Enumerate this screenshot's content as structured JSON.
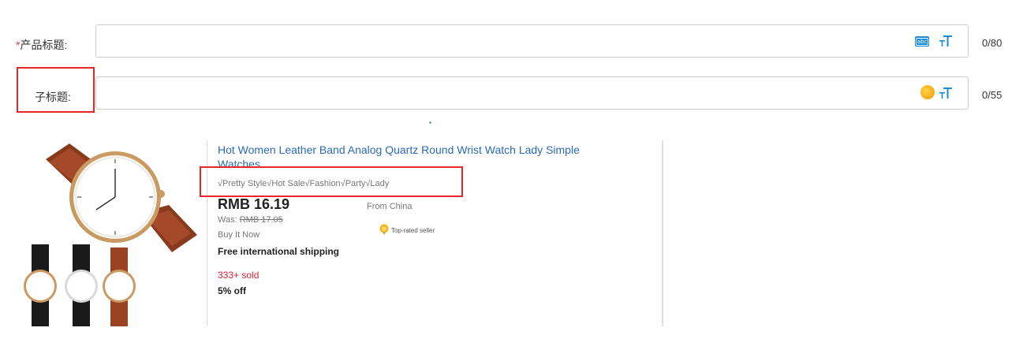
{
  "form": {
    "title_row": {
      "required_mark": "*",
      "label": "产品标题:",
      "value": "",
      "counter": "0/80",
      "abc_icon_text": "abc"
    },
    "subtitle_row": {
      "label": "子标题:",
      "value": "",
      "counter": "0/55"
    }
  },
  "listing": {
    "title_line1": "Hot Women Leather Band Analog Quartz Round Wrist Watch Lady Simple",
    "title_line2": "Watches",
    "subtitle": "√Pretty Style√Hot Sale√Fashion√Party√Lady",
    "price": "RMB 16.19",
    "was_label": "Was:",
    "was_price": "RMB 17.05",
    "buy_format": "Buy It Now",
    "shipping": "Free international shipping",
    "sold": "333+ sold",
    "discount": "5% off",
    "origin": "From China",
    "seller_badge": "Top-rated seller"
  },
  "colors": {
    "highlight": "#e8262a",
    "link": "#2a6bb8",
    "sold": "#dd1e31",
    "accent_blue": "#1a8bd6",
    "sun_orange": "#f7a90d"
  },
  "icons": {
    "title_row": [
      "abc-spellcheck-icon",
      "text-size-icon"
    ],
    "subtitle_row": [
      "emoji-sun-icon",
      "text-size-icon"
    ],
    "listing": [
      "watch-product-image",
      "top-rated-seller-badge-icon"
    ]
  }
}
